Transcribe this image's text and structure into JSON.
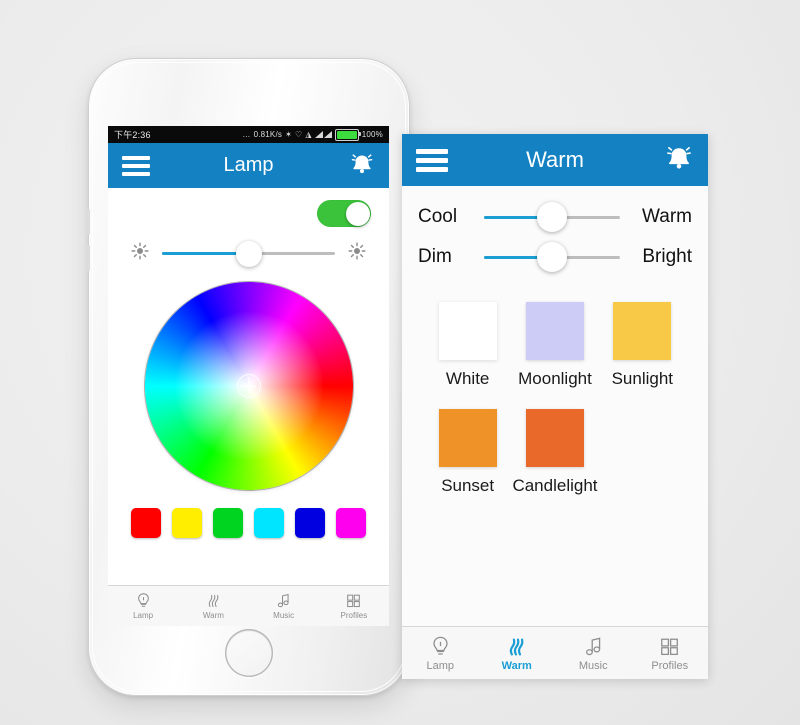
{
  "status_bar": {
    "time": "下午2:36",
    "network_speed": "0.81K/s",
    "dots": "…",
    "bluetooth_icon": "bluetooth-icon",
    "shield_icon": "shield-icon",
    "wifi_icon": "wifi-icon",
    "signal_icon": "signal-bars-icon",
    "battery_text": "100%"
  },
  "left_screen": {
    "appbar": {
      "menu_icon": "hamburger-menu-icon",
      "title": "Lamp",
      "right_icon": "bell-icon"
    },
    "power_toggle": {
      "state": "on",
      "color": "#3bc43b"
    },
    "brightness_slider": {
      "low_icon": "brightness-low-icon",
      "high_icon": "brightness-high-icon",
      "value": 50,
      "fill_color": "#1a9ed4",
      "track_color": "#bdbdbd"
    },
    "color_wheel": {
      "selector": "color-picker-handle",
      "selected_position": "center"
    },
    "swatches": [
      {
        "name": "red",
        "color": "#ff0000"
      },
      {
        "name": "yellow",
        "color": "#ffee00"
      },
      {
        "name": "green",
        "color": "#00d420"
      },
      {
        "name": "cyan",
        "color": "#00e5ff"
      },
      {
        "name": "blue",
        "color": "#0000e0"
      },
      {
        "name": "magenta",
        "color": "#ff00ee"
      }
    ],
    "tabs": [
      {
        "label": "Lamp",
        "icon": "lightbulb-icon",
        "active": false
      },
      {
        "label": "Warm",
        "icon": "flame-icon",
        "active": false
      },
      {
        "label": "Music",
        "icon": "music-note-icon",
        "active": false
      },
      {
        "label": "Profiles",
        "icon": "grid-icon",
        "active": false
      }
    ]
  },
  "right_screen": {
    "appbar": {
      "menu_icon": "hamburger-menu-icon",
      "title": "Warm",
      "right_icon": "bell-icon"
    },
    "sliders": [
      {
        "left_label": "Cool",
        "right_label": "Warm",
        "value": 50
      },
      {
        "left_label": "Dim",
        "right_label": "Bright",
        "value": 50
      }
    ],
    "presets_row1": [
      {
        "label": "White",
        "color": "#ffffff"
      },
      {
        "label": "Moonlight",
        "color": "#ccccf6"
      },
      {
        "label": "Sunlight",
        "color": "#f7c946"
      }
    ],
    "presets_row2": [
      {
        "label": "Sunset",
        "color": "#ef9328"
      },
      {
        "label": "Candlelight",
        "color": "#e8692a"
      }
    ],
    "tabs": [
      {
        "label": "Lamp",
        "icon": "lightbulb-icon",
        "active": false
      },
      {
        "label": "Warm",
        "icon": "flame-icon",
        "active": true
      },
      {
        "label": "Music",
        "icon": "music-note-icon",
        "active": false
      },
      {
        "label": "Profiles",
        "icon": "grid-icon",
        "active": false
      }
    ]
  },
  "theme": {
    "header_blue": "#1481c2",
    "accent_blue": "#1a9ed4",
    "background": "#ececec"
  }
}
